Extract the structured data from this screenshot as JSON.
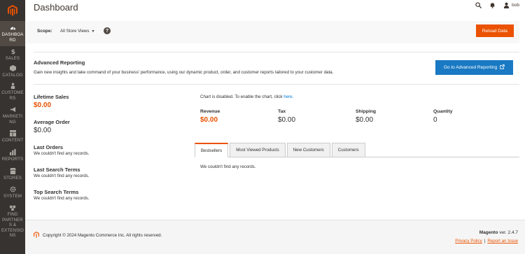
{
  "header": {
    "title": "Dashboard",
    "user_name": "bob"
  },
  "nav": {
    "items": [
      {
        "label": "DASHBOARD",
        "icon": "dashboard-icon"
      },
      {
        "label": "SALES",
        "icon": "dollar-icon"
      },
      {
        "label": "CATALOG",
        "icon": "cube-icon"
      },
      {
        "label": "CUSTOMERS",
        "icon": "person-icon"
      },
      {
        "label": "MARKETING",
        "icon": "megaphone-icon"
      },
      {
        "label": "CONTENT",
        "icon": "layout-icon"
      },
      {
        "label": "REPORTS",
        "icon": "bar-chart-icon"
      },
      {
        "label": "STORES",
        "icon": "store-icon"
      },
      {
        "label": "SYSTEM",
        "icon": "gear-icon"
      },
      {
        "label": "FIND PARTNERS & EXTENSIONS",
        "icon": "puzzle-icon"
      }
    ]
  },
  "scope": {
    "label": "Scope:",
    "value": "All Store Views",
    "help": "?"
  },
  "reload_button": "Reload Data",
  "advanced": {
    "title": "Advanced Reporting",
    "text": "Gain new insights and take command of your business' performance, using our dynamic product, order, and customer reports tailored to your customer data.",
    "button": "Go to Advanced Reporting"
  },
  "stats": {
    "lifetime_label": "Lifetime Sales",
    "lifetime_value": "$0.00",
    "average_label": "Average Order",
    "average_value": "$0.00",
    "last_orders_label": "Last Orders",
    "last_orders_text": "We couldn't find any records.",
    "last_search_label": "Last Search Terms",
    "last_search_text": "We couldn't find any records.",
    "top_search_label": "Top Search Terms",
    "top_search_text": "We couldn't find any records."
  },
  "chart": {
    "note": "Chart is disabled. To enable the chart, click ",
    "link": "here."
  },
  "totals": {
    "revenue_label": "Revenue",
    "revenue_value": "$0.00",
    "tax_label": "Tax",
    "tax_value": "$0.00",
    "shipping_label": "Shipping",
    "shipping_value": "$0.00",
    "quantity_label": "Quantity",
    "quantity_value": "0"
  },
  "tabs": {
    "items": [
      "Bestsellers",
      "Most Viewed Products",
      "New Customers",
      "Customers"
    ],
    "active": "Bestsellers",
    "content": "We couldn't find any records."
  },
  "footer": {
    "copyright": "Copyright © 2024 Magento Commerce Inc. All rights reserved.",
    "brand": "Magento",
    "version": " ver. 2.4.7",
    "privacy": "Privacy Policy",
    "separator": "|",
    "report": "Report an Issue"
  },
  "colors": {
    "accent": "#eb5202",
    "sidebar": "#373330",
    "link_blue": "#1979c3"
  }
}
